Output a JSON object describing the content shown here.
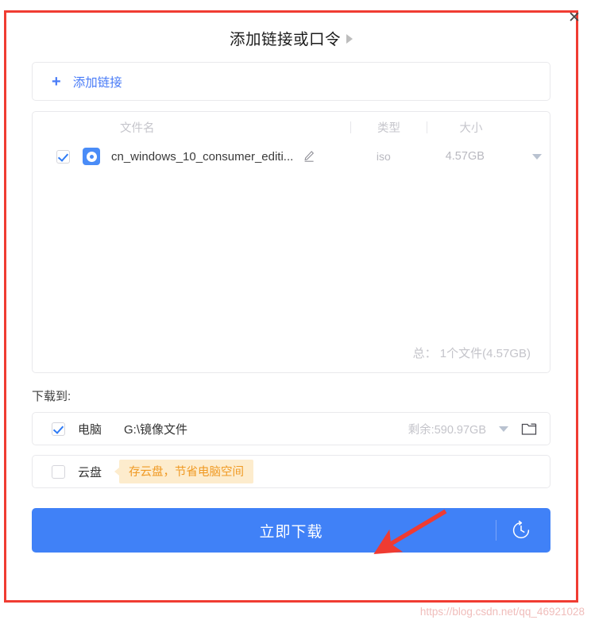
{
  "dialog": {
    "title": "添加链接或口令",
    "close_label": "✕",
    "add_link": {
      "plus": "+",
      "label": "添加链接"
    },
    "file_table": {
      "headers": {
        "name": "文件名",
        "type": "类型",
        "size": "大小"
      },
      "rows": [
        {
          "checked": true,
          "icon": "iso-disc-icon",
          "name": "cn_windows_10_consumer_editi...",
          "type": "iso",
          "size": "4.57GB"
        }
      ],
      "total": "总：  1个文件(4.57GB)"
    },
    "download_to_label": "下载到:",
    "destinations": [
      {
        "checked": true,
        "name": "电脑",
        "path": "G:\\镜像文件",
        "space": "剩余:590.97GB"
      },
      {
        "checked": false,
        "name": "云盘",
        "badge": "存云盘，节省电脑空间"
      }
    ],
    "download_button": {
      "label": "立即下载",
      "timer_icon": "scheduled-download-clock-icon"
    }
  },
  "watermark": "https://blog.csdn.net/qq_46921028",
  "colors": {
    "accent_blue": "#4081f7",
    "link_blue": "#4a7cf7",
    "badge_bg": "#fdeccd",
    "badge_text": "#f09a24",
    "annotation_red": "#f03c32",
    "muted_gray": "#c4c4ca"
  }
}
